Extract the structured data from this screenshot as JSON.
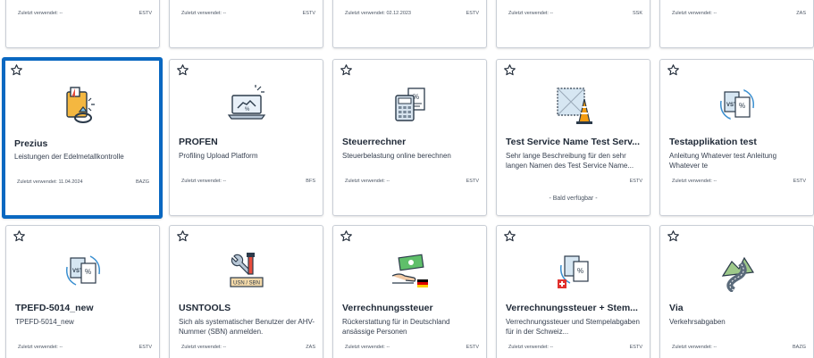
{
  "last_used_label": "Zuletzt verwendet:",
  "coming_soon": "- Bald verfügbar -",
  "top_row": [
    {
      "last_used": "--",
      "agency": "ESTV"
    },
    {
      "last_used": "--",
      "agency": "ESTV"
    },
    {
      "last_used": "02.12.2023",
      "agency": "ESTV"
    },
    {
      "last_used": "--",
      "agency": "SSK"
    },
    {
      "last_used": "--",
      "agency": "ZAS"
    }
  ],
  "middle_row": [
    {
      "title": "Prezius",
      "description": "Leistungen der Edelmetallkontrolle",
      "last_used": "11.04.2024",
      "agency": "BAZG",
      "icon": "precious-metal-icon"
    },
    {
      "title": "PROFEN",
      "description": "Profiling Upload Platform",
      "last_used": "--",
      "agency": "BFS",
      "icon": "laptop-handshake-icon"
    },
    {
      "title": "Steuerrechner",
      "description": "Steuerbelastung online berechnen",
      "last_used": "--",
      "agency": "ESTV",
      "icon": "calculator-icon"
    },
    {
      "title": "Test Service Name Test Serv...",
      "description": "Sehr lange Beschreibung für den sehr langen Namen des Test Service Name...",
      "last_used": "",
      "agency": "ESTV",
      "icon": "construction-cone-icon",
      "coming_soon": true
    },
    {
      "title": "Testapplikation test",
      "description": "Anleitung Whatever test Anleitung Whatever te",
      "last_used": "--",
      "agency": "ESTV",
      "icon": "vat-document-icon"
    }
  ],
  "bottom_row": [
    {
      "title": "TPEFD-5014_new",
      "description": "TPEFD-5014_new",
      "last_used": "--",
      "agency": "ESTV",
      "icon": "vat-document-icon"
    },
    {
      "title": "USNTOOLS",
      "description": "Sich als systematischer Benutzer der AHV-Nummer (SBN) anmelden.",
      "last_used": "--",
      "agency": "ZAS",
      "icon": "tools-icon",
      "badge": "USN / SBN"
    },
    {
      "title": "Verrechnungssteuer",
      "description": "Rückerstattung für in Deutschland ansässige Personen",
      "last_used": "--",
      "agency": "ESTV",
      "icon": "money-refund-de-icon"
    },
    {
      "title": "Verrechnungssteuer + Stem...",
      "description": "Verrechnungssteuer und Stempelabgaben für in der Schweiz...",
      "last_used": "--",
      "agency": "ESTV",
      "icon": "tax-ch-icon"
    },
    {
      "title": "Via",
      "description": "Verkehrsabgaben",
      "last_used": "--",
      "agency": "BAZG",
      "icon": "road-icon"
    }
  ],
  "colors": {
    "accent": "#0a68c1",
    "border": "#c9ced6"
  }
}
